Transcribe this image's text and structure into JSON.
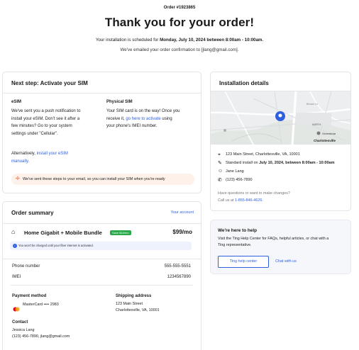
{
  "header": {
    "order_number": "Order #1923865",
    "title": "Thank you for your order!",
    "schedule_prefix": "Your installation is scheduled for ",
    "schedule_date": "Monday, July 10, 2024 between 8:00am - 10:00am.",
    "email_confirmation": "We've emailed your order confirmation to [jlang@gmail.com]."
  },
  "next_step": {
    "heading": "Next step: Activate your SIM",
    "esim_title": "eSIM",
    "esim_text_1": "We've sent you a push notification to",
    "esim_text_2": "install your eSIM. Don't see it after a",
    "esim_text_3": "few minutes? Go to your system",
    "esim_text_4": "settings under \"Cellular\".",
    "esim_alt_prefix": "Alternatively, ",
    "esim_alt_link_1": "install your eSIM",
    "esim_alt_link_2": "manually.",
    "physical_title": "Physical SIM",
    "physical_text_1": "Your SIM card is on the way! Once you",
    "physical_text_2_prefix": "receive it, ",
    "physical_text_2_link": "go here to activate",
    "physical_text_2_suffix": " using",
    "physical_text_3": "your phone's IMEI number.",
    "notice": "We've sent these steps to your email, so you can install your SIM when you're ready"
  },
  "installation": {
    "heading": "Installation details",
    "map_labels": {
      "north_label": "NORTH",
      "greenbriar": "Greenbriar",
      "charlottesville": "Charlottesville",
      "lane": "Birnam Ln"
    },
    "address": "123 Main Street, Charlottesville, VA, 10001",
    "install_prefix": "Standard install on ",
    "install_date": "July 10, 2024, between 8:00am - 10:00am",
    "contact_name": "Jane Lang",
    "contact_phone": "(123) 456-7890",
    "questions": "Have questions or want to make changes?",
    "call_prefix": "Call us at ",
    "call_number": "1-855-846-4626."
  },
  "help": {
    "heading": "We're here to help",
    "text_1": "Visit the Ting Help Center for FAQs, helpful articles, or chat with a",
    "text_2": "Ting representative.",
    "help_center_label": "Ting help center",
    "chat_label": "Chat with us"
  },
  "order_summary": {
    "heading": "Order summary",
    "account_link": "Your account",
    "plan_name": "Home Gigabit + Mobile Bundle",
    "save_badge": "Save $15/mo",
    "plan_price": "$99/mo",
    "info_text": "You won't be charged until your fiber internet is activated.",
    "phone_label": "Phone number",
    "phone_value": "555-555-5551",
    "imei_label": "IMEI",
    "imei_value": "1234567890",
    "payment_title": "Payment method",
    "payment_value": "MasterCard •••• 2983",
    "shipping_title": "Shipping address",
    "shipping_line_1": "123 Main Street",
    "shipping_line_2": "Charlottesville, VA, 10001",
    "contact_title": "Contact",
    "contact_name": "Jessica Lang",
    "contact_details": "(123) 456-7890, jlang@gmail.com"
  },
  "colors": {
    "accent": "#2f5fe0",
    "save_green": "#2aa84a",
    "notice_bg": "#fdf1ea",
    "warn_orange": "#e55a2b"
  }
}
